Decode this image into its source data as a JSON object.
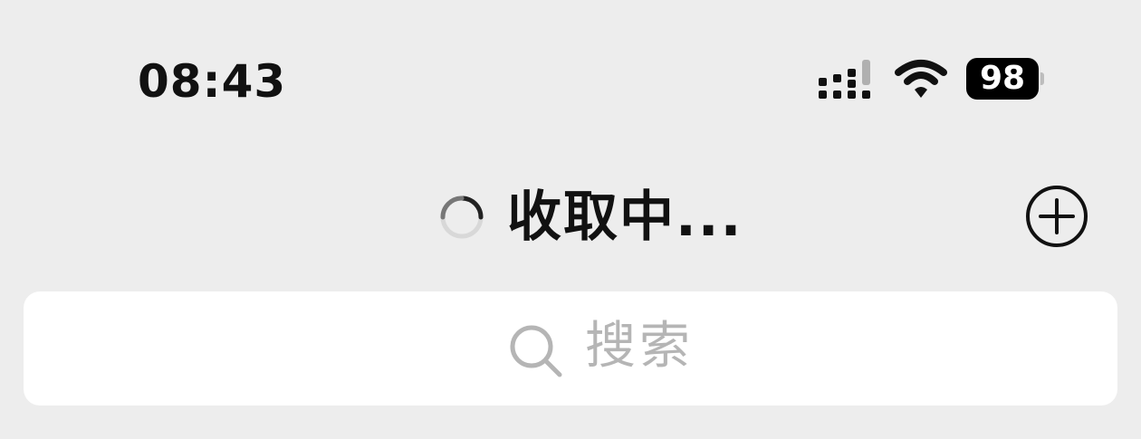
{
  "status_bar": {
    "time": "08:43",
    "battery_level": "98",
    "signal_icon": "cellular-signal-icon",
    "wifi_icon": "wifi-icon"
  },
  "nav": {
    "title": "收取中...",
    "spinner_icon": "loading-spinner-icon",
    "add_icon": "add-circle-icon"
  },
  "search": {
    "placeholder": "搜索",
    "icon": "search-icon"
  },
  "colors": {
    "background": "#ededed",
    "search_field": "#ffffff",
    "placeholder": "#b5b5b5",
    "text": "#111111"
  }
}
